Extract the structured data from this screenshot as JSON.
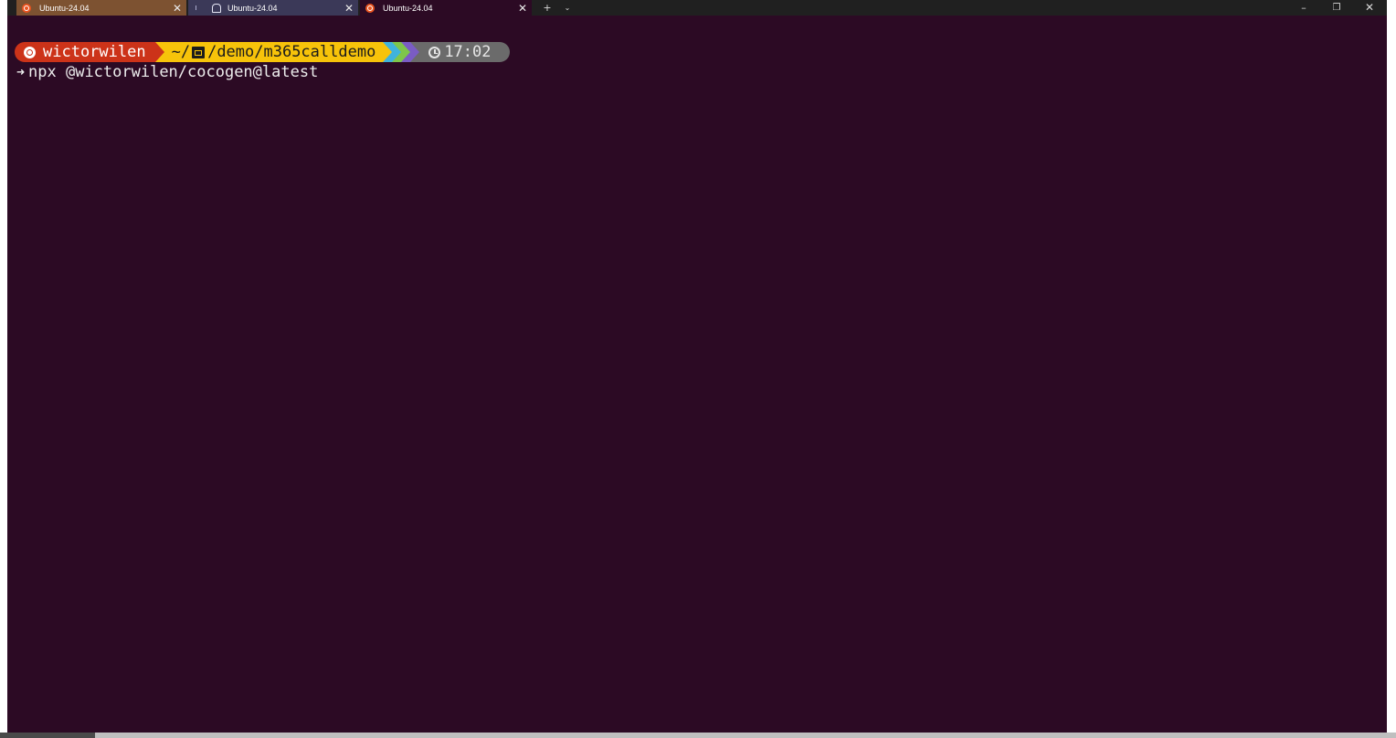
{
  "window": {
    "tabs": [
      {
        "label": "Ubuntu-24.04",
        "close": "✕"
      },
      {
        "label": "Ubuntu-24.04",
        "close": "✕"
      },
      {
        "label": "Ubuntu-24.04",
        "close": "✕"
      }
    ],
    "new_tab": "+",
    "dropdown": "⌄",
    "minimize": "–",
    "restore": "❐",
    "close": "✕"
  },
  "terminal": {
    "prompt": {
      "user": "wictorwilen",
      "path_prefix": "~/",
      "path": "/demo/m365calldemo",
      "time": "17:02"
    },
    "command_arrow": "➜",
    "command": "npx @wictorwilen/cocogen@latest"
  },
  "colors": {
    "terminal_bg": "#2c0a24",
    "user_segment": "#cc3319",
    "path_segment": "#f7c30a",
    "time_segment": "#6b6b6b",
    "tab_1": "#7d5231",
    "tab_2": "#3b3958"
  },
  "icons": {
    "tab_1": "ubuntu-icon",
    "tab_2": "bell-icon",
    "tab_3": "ubuntu-icon",
    "user": "ubuntu-icon",
    "path": "folder-code-icon",
    "time": "clock-icon"
  }
}
